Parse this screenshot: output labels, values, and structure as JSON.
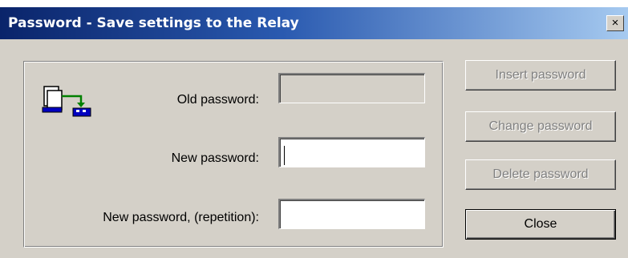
{
  "window": {
    "title": "Password - Save settings to the Relay",
    "close_glyph": "×"
  },
  "icon": {
    "name": "transfer-to-relay-icon"
  },
  "form": {
    "old_password_label": "Old password:",
    "old_password_value": "",
    "new_password_label": "New password:",
    "new_password_value": "",
    "repeat_password_label": "New password, (repetition):",
    "repeat_password_value": ""
  },
  "buttons": {
    "insert_password": "Insert password",
    "change_password": "Change password",
    "delete_password": "Delete password",
    "close": "Close"
  }
}
